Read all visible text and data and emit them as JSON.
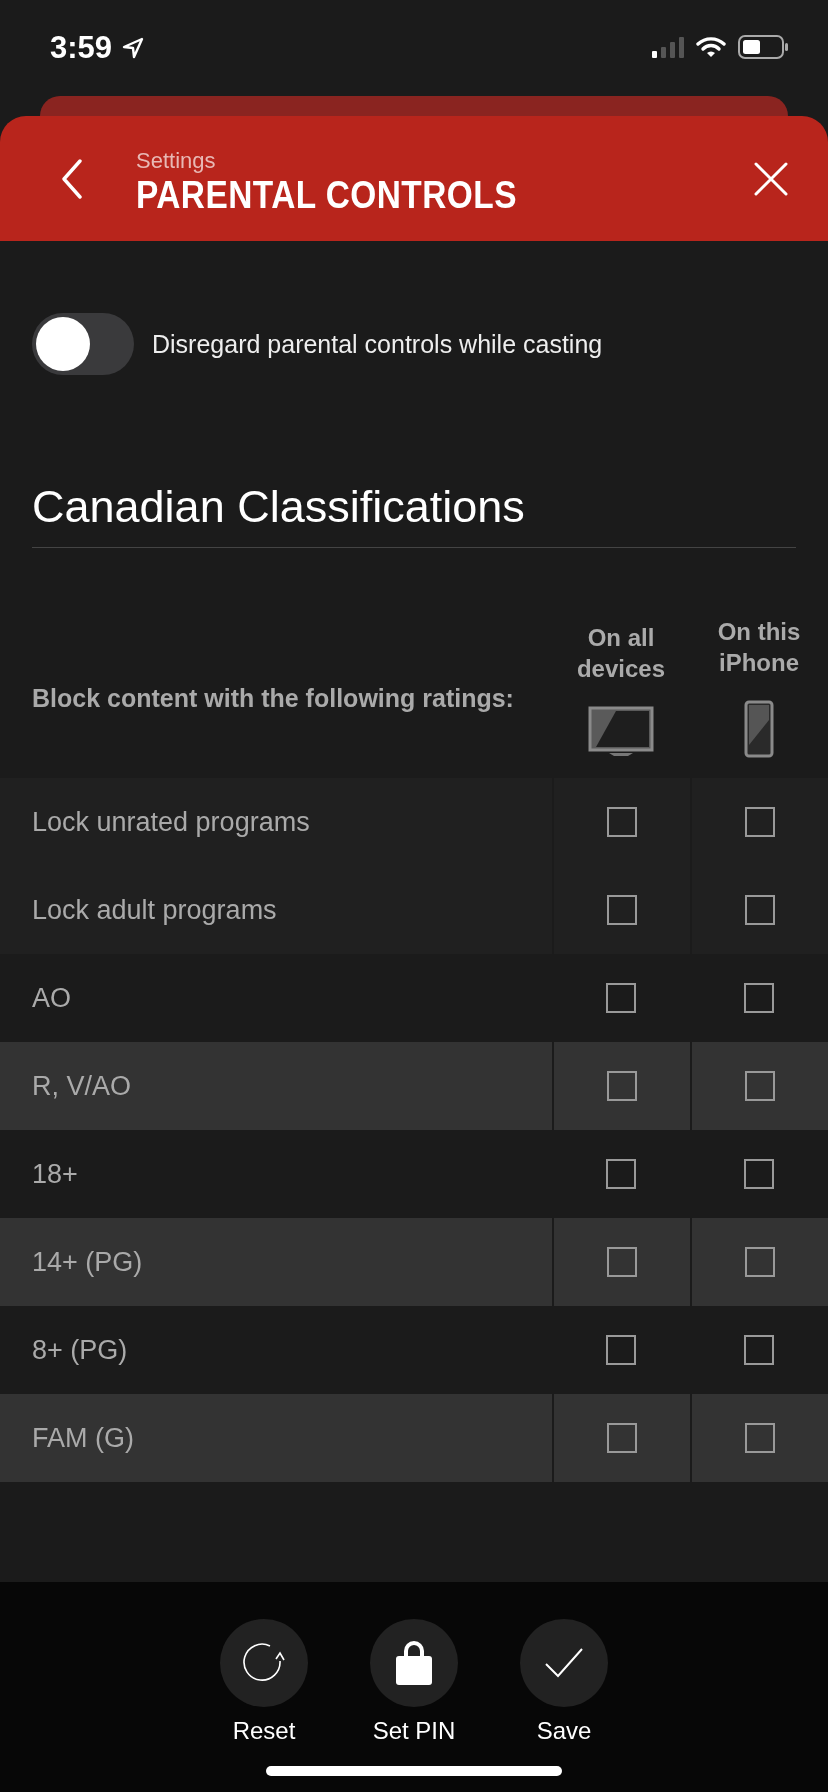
{
  "status_bar": {
    "time": "3:59"
  },
  "header": {
    "subtitle": "Settings",
    "title": "PARENTAL CONTROLS"
  },
  "cast_toggle": {
    "label": "Disregard parental controls while casting",
    "on": false
  },
  "section": {
    "title": "Canadian Classifications"
  },
  "table": {
    "caption": "Block content with the following ratings:",
    "columns": [
      {
        "label": "On all devices",
        "kind": "tv"
      },
      {
        "label": "On this iPhone",
        "kind": "phone"
      }
    ],
    "rows": [
      {
        "label": "Lock unrated programs",
        "kind": "lock",
        "checked": [
          false,
          false
        ]
      },
      {
        "label": "Lock adult programs",
        "kind": "lock",
        "checked": [
          false,
          false
        ]
      },
      {
        "label": "AO",
        "kind": "rating",
        "checked": [
          false,
          false
        ]
      },
      {
        "label": "R, V/AO",
        "kind": "rating",
        "checked": [
          false,
          false
        ]
      },
      {
        "label": "18+",
        "kind": "rating",
        "checked": [
          false,
          false
        ]
      },
      {
        "label": "14+ (PG)",
        "kind": "rating",
        "checked": [
          false,
          false
        ]
      },
      {
        "label": "8+ (PG)",
        "kind": "rating",
        "checked": [
          false,
          false
        ]
      },
      {
        "label": "FAM (G)",
        "kind": "rating",
        "checked": [
          false,
          false
        ]
      }
    ]
  },
  "actions": [
    {
      "label": "Reset",
      "kind": "reset"
    },
    {
      "label": "Set PIN",
      "kind": "lock"
    },
    {
      "label": "Save",
      "kind": "save"
    }
  ]
}
